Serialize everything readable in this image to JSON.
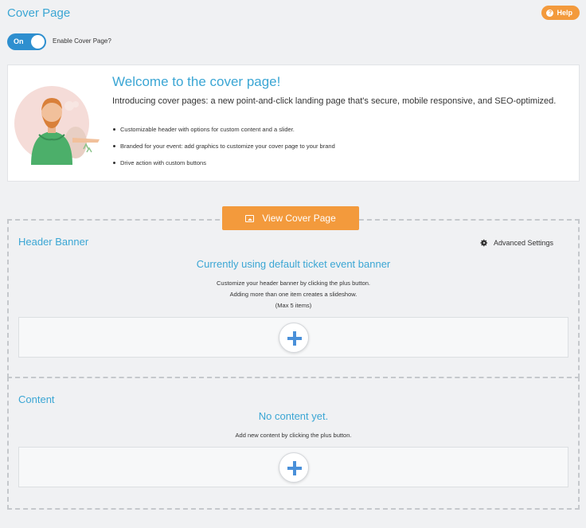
{
  "page": {
    "title": "Cover Page"
  },
  "help": {
    "label": "Help",
    "icon": "help-circle-icon"
  },
  "toggle": {
    "state_label": "On",
    "label": "Enable Cover Page?"
  },
  "welcome": {
    "title": "Welcome to the cover page!",
    "intro": "Introducing cover pages: a new point-and-click landing page that's secure, mobile responsive, and SEO-optimized.",
    "bullets": [
      "Customizable header with options for custom content and a slider.",
      "Branded for your event: add graphics to customize your cover page to your brand",
      "Drive action with custom buttons"
    ]
  },
  "view_cover": {
    "label": "View Cover Page",
    "icon": "image-icon"
  },
  "header_banner": {
    "title": "Header Banner",
    "advanced_label": "Advanced Settings",
    "status": "Currently using default ticket event banner",
    "help_lines": [
      "Customize your header banner by clicking the plus button.",
      "Adding more than one item creates a slideshow.",
      "(Max 5 items)"
    ]
  },
  "content": {
    "title": "Content",
    "status": "No content yet.",
    "help_line": "Add new content by clicking the plus button."
  },
  "colors": {
    "accent_blue": "#3ba6d4",
    "toggle_blue": "#2e8fcf",
    "orange": "#f39a3c",
    "plus_blue": "#4a90d9"
  }
}
